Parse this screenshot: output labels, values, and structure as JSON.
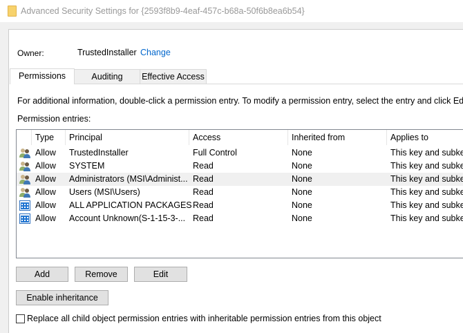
{
  "window": {
    "title": "Advanced Security Settings for {2593f8b9-4eaf-457c-b68a-50f6b8ea6b54}"
  },
  "owner": {
    "label": "Owner:",
    "value": "TrustedInstaller",
    "change": "Change"
  },
  "tabs": [
    {
      "label": "Permissions"
    },
    {
      "label": "Auditing"
    },
    {
      "label": "Effective Access"
    }
  ],
  "info": "For additional information, double-click a permission entry. To modify a permission entry, select the entry and click Edit (if",
  "entries_label": "Permission entries:",
  "columns": [
    "Type",
    "Principal",
    "Access",
    "Inherited from",
    "Applies to"
  ],
  "rows": [
    {
      "icon": "users",
      "type": "Allow",
      "principal": "TrustedInstaller",
      "access": "Full Control",
      "inherited": "None",
      "applies": "This key and subkeys"
    },
    {
      "icon": "users",
      "type": "Allow",
      "principal": "SYSTEM",
      "access": "Read",
      "inherited": "None",
      "applies": "This key and subkeys"
    },
    {
      "icon": "users",
      "type": "Allow",
      "principal": "Administrators (MSI\\Administ...",
      "access": "Read",
      "inherited": "None",
      "applies": "This key and subkeys"
    },
    {
      "icon": "users",
      "type": "Allow",
      "principal": "Users (MSI\\Users)",
      "access": "Read",
      "inherited": "None",
      "applies": "This key and subkeys"
    },
    {
      "icon": "app-package",
      "type": "Allow",
      "principal": "ALL APPLICATION PACKAGES",
      "access": "Read",
      "inherited": "None",
      "applies": "This key and subkeys"
    },
    {
      "icon": "app-package",
      "type": "Allow",
      "principal": "Account Unknown(S-1-15-3-...",
      "access": "Read",
      "inherited": "None",
      "applies": "This key and subkeys"
    }
  ],
  "buttons": {
    "add": "Add",
    "remove": "Remove",
    "edit": "Edit",
    "enable_inheritance": "Enable inheritance"
  },
  "replace_checkbox": "Replace all child object permission entries with inheritable permission entries from this object"
}
